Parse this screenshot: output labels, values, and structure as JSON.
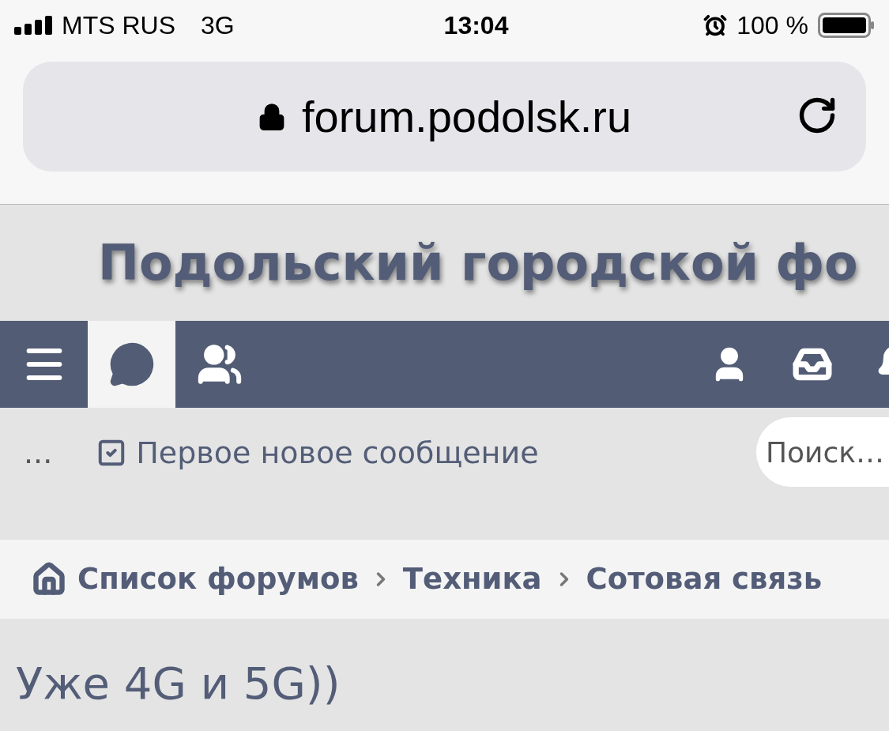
{
  "status_bar": {
    "carrier": "MTS RUS",
    "network": "3G",
    "time": "13:04",
    "battery": "100 %"
  },
  "browser": {
    "url": "forum.podolsk.ru"
  },
  "site_title": "Подольский городской фо",
  "nav": {
    "tabs": [
      {
        "kind": "menu",
        "selected": false
      },
      {
        "kind": "forums",
        "selected": true
      },
      {
        "kind": "members",
        "selected": false
      }
    ],
    "actions": [
      {
        "kind": "user"
      },
      {
        "kind": "inbox"
      },
      {
        "kind": "bell"
      }
    ]
  },
  "toolbar": {
    "more": "...",
    "new_post_link": "Первое новое сообщение",
    "search": {
      "placeholder": "Поиск…"
    }
  },
  "breadcrumbs": [
    "Список форумов",
    "Техника",
    "Сотовая связь"
  ],
  "thread_title": "Уже 4G и 5G))"
}
